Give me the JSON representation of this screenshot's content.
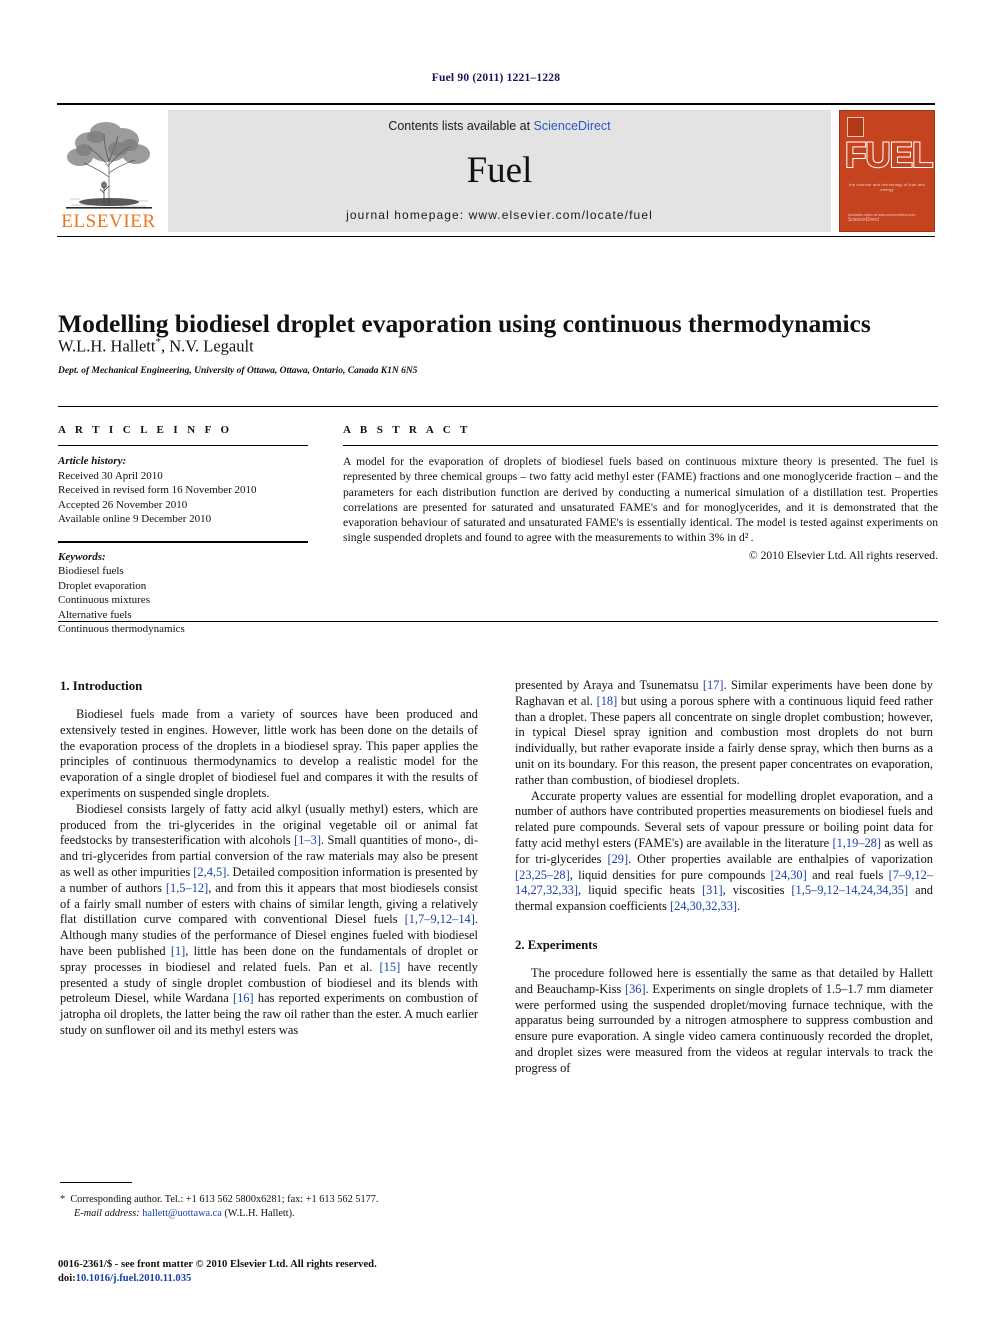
{
  "running_head": "Fuel 90 (2011) 1221–1228",
  "header": {
    "contents_prefix": "Contents lists available at ",
    "sciencedirect": "ScienceDirect",
    "journal_name": "Fuel",
    "homepage": "journal homepage: www.elsevier.com/locate/fuel",
    "publisher_wordmark": "ELSEVIER",
    "cover_title": "FUEL",
    "cover_tagline": "the science and technology of fuel and energy",
    "cover_footer_line1": "Available online at www.sciencedirect.com",
    "cover_footer_line2": "ScienceDirect",
    "link_color": "#2b56c4",
    "band_color": "#e3e3e3",
    "cover_color": "#c5441f",
    "elsevier_orange": "#e87722"
  },
  "article": {
    "title": "Modelling biodiesel droplet evaporation using continuous thermodynamics",
    "authors": "W.L.H. Hallett",
    "corresponding_mark": "*",
    "authors_rest": ", N.V. Legault",
    "affiliation": "Dept. of Mechanical Engineering, University of Ottawa, Ottawa, Ontario, Canada K1N 6N5"
  },
  "article_info": {
    "heading": "A R T I C L E   I N F O",
    "history_label": "Article history:",
    "history": [
      "Received 30 April 2010",
      "Received in revised form 16 November 2010",
      "Accepted 26 November 2010",
      "Available online 9 December 2010"
    ],
    "keywords_label": "Keywords:",
    "keywords": [
      "Biodiesel fuels",
      "Droplet evaporation",
      "Continuous mixtures",
      "Alternative fuels",
      "Continuous thermodynamics"
    ]
  },
  "abstract": {
    "heading": "A B S T R A C T",
    "text": "A model for the evaporation of droplets of biodiesel fuels based on continuous mixture theory is presented. The fuel is represented by three chemical groups – two fatty acid methyl ester (FAME) fractions and one monoglyceride fraction – and the parameters for each distribution function are derived by conducting a numerical simulation of a distillation test. Properties correlations are presented for saturated and unsaturated FAME's and for monoglycerides, and it is demonstrated that the evaporation behaviour of saturated and unsaturated FAME's is essentially identical. The model is tested against experiments on single suspended droplets and found to agree with the measurements to within 3% in d² .",
    "copyright": "© 2010 Elsevier Ltd. All rights reserved."
  },
  "sections": {
    "intro_heading": "1. Introduction",
    "intro_p1": "Biodiesel fuels made from a variety of sources have been produced and extensively tested in engines. However, little work has been done on the details of the evaporation process of the droplets in a biodiesel spray. This paper applies the principles of continuous thermodynamics to develop a realistic model for the evaporation of a single droplet of biodiesel fuel and compares it with the results of experiments on suspended single droplets.",
    "intro_p2_a": "Biodiesel consists largely of fatty acid alkyl (usually methyl) esters, which are produced from the tri-glycerides in the original vegetable oil or animal fat feedstocks by transesterification with alcohols ",
    "intro_p2_r1": "[1–3]",
    "intro_p2_b": ". Small quantities of mono-, di- and tri-glycerides from partial conversion of the raw materials may also be present as well as other impurities ",
    "intro_p2_r2": "[2,4,5]",
    "intro_p2_c": ". Detailed composition information is presented by a number of authors ",
    "intro_p2_r3": "[1,5–12]",
    "intro_p2_d": ", and from this it appears that most biodiesels consist of a fairly small number of esters with chains of similar length, giving a relatively flat distillation curve compared with conventional Diesel fuels ",
    "intro_p2_r4": "[1,7–9,12–14]",
    "intro_p2_e": ". Although many studies of the performance of Diesel engines fueled with biodiesel have been published ",
    "intro_p2_r5": "[1]",
    "intro_p2_f": ", little has been done on the fundamentals of droplet or spray processes in biodiesel and related fuels. Pan et al. ",
    "intro_p2_r6": "[15]",
    "intro_p2_g": " have recently presented a study of single droplet combustion of biodiesel and its blends with petroleum Diesel, while Wardana ",
    "intro_p2_r7": "[16]",
    "intro_p2_h": " has reported experiments on combustion of jatropha oil droplets, the latter being the raw oil rather than the ester. A much earlier study on sunflower oil and its methyl esters was",
    "intro_p3_a": "presented by Araya and Tsunematsu ",
    "intro_p3_r1": "[17]",
    "intro_p3_b": ". Similar experiments have been done by Raghavan et al. ",
    "intro_p3_r2": "[18]",
    "intro_p3_c": " but using a porous sphere with a continuous liquid feed rather than a droplet. These papers all concentrate on single droplet combustion; however, in typical Diesel spray ignition and combustion most droplets do not burn individually, but rather evaporate inside a fairly dense spray, which then burns as a unit on its boundary. For this reason, the present paper concentrates on evaporation, rather than combustion, of biodiesel droplets.",
    "intro_p4_a": "Accurate property values are essential for modelling droplet evaporation, and a number of authors have contributed properties measurements on biodiesel fuels and related pure compounds. Several sets of vapour pressure or boiling point data for fatty acid methyl esters (FAME's) are available in the literature ",
    "intro_p4_r1": "[1,19–28]",
    "intro_p4_b": " as well as for tri-glycerides ",
    "intro_p4_r2": "[29]",
    "intro_p4_c": ". Other properties available are enthalpies of vaporization ",
    "intro_p4_r3": "[23,25–28]",
    "intro_p4_d": ", liquid densities for pure compounds ",
    "intro_p4_r4": "[24,30]",
    "intro_p4_e": " and real fuels ",
    "intro_p4_r5": "[7–9,12–14,27,32,33]",
    "intro_p4_f": ", liquid specific heats ",
    "intro_p4_r6": "[31]",
    "intro_p4_g": ", viscosities ",
    "intro_p4_r7": "[1,5–9,12–14,24,34,35]",
    "intro_p4_h": " and thermal expansion coefficients ",
    "intro_p4_r8": "[24,30,32,33]",
    "intro_p4_i": ".",
    "exp_heading": "2. Experiments",
    "exp_p1_a": "The procedure followed here is essentially the same as that detailed by Hallett and Beauchamp-Kiss ",
    "exp_p1_r1": "[36]",
    "exp_p1_b": ". Experiments on single droplets of 1.5–1.7 mm diameter were performed using the suspended droplet/moving furnace technique, with the apparatus being surrounded by a nitrogen atmosphere to suppress combustion and ensure pure evaporation. A single video camera continuously recorded the droplet, and droplet sizes were measured from the videos at regular intervals to track the progress of"
  },
  "footnote": {
    "star": "*",
    "corresponding": "Corresponding author. Tel.: +1 613 562 5800x6281; fax: +1 613 562 5177.",
    "email_label": "E-mail address:",
    "email": "hallett@uottawa.ca",
    "email_owner": "(W.L.H. Hallett)."
  },
  "imprint": {
    "line1": "0016-2361/$ - see front matter © 2010 Elsevier Ltd. All rights reserved.",
    "doi_label": "doi:",
    "doi": "10.1016/j.fuel.2010.11.035"
  }
}
